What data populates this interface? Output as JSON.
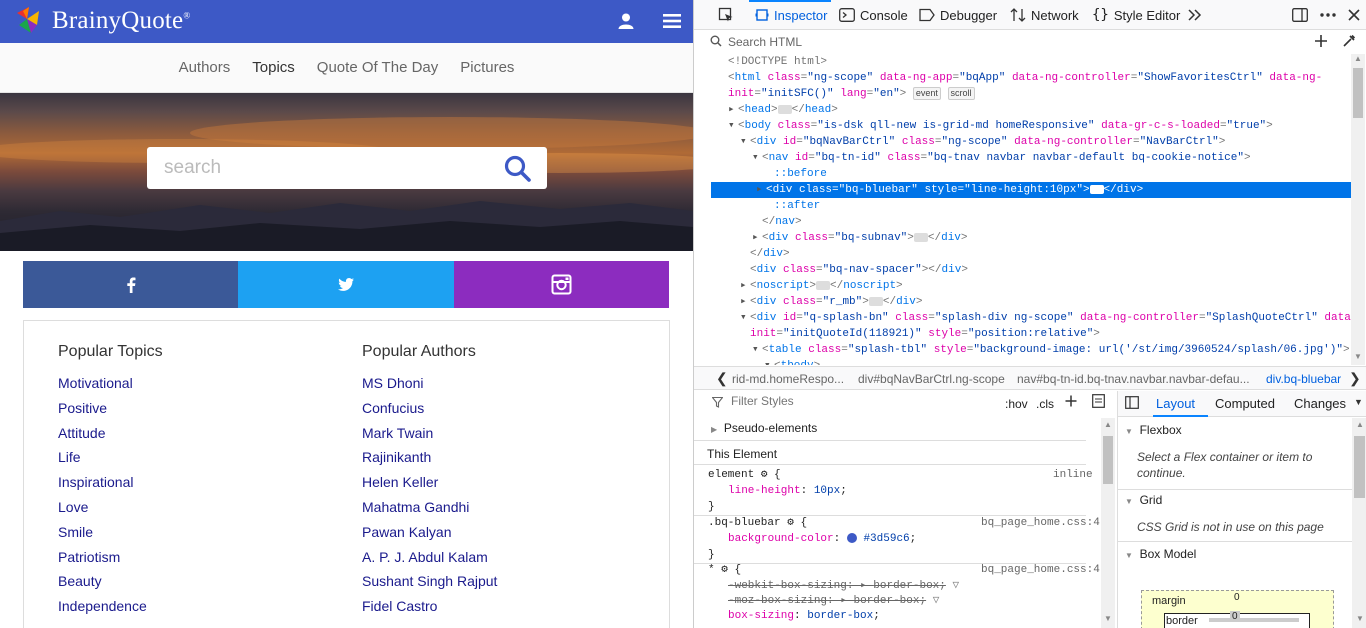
{
  "site": {
    "logo_text": "BrainyQuote",
    "logo_reg": "®",
    "subnav": [
      "Authors",
      "Topics",
      "Quote Of The Day",
      "Pictures"
    ],
    "active_subnav": "Topics",
    "search_placeholder": "search",
    "popular_topics_title": "Popular Topics",
    "popular_topics": [
      "Motivational",
      "Positive",
      "Attitude",
      "Life",
      "Inspirational",
      "Love",
      "Smile",
      "Patriotism",
      "Beauty",
      "Independence"
    ],
    "popular_authors_title": "Popular Authors",
    "popular_authors": [
      "MS Dhoni",
      "Confucius",
      "Mark Twain",
      "Rajinikanth",
      "Helen Keller",
      "Mahatma Gandhi",
      "Pawan Kalyan",
      "A. P. J. Abdul Kalam",
      "Sushant Singh Rajput",
      "Fidel Castro"
    ],
    "colors": {
      "bluebar": "#3d59c6",
      "facebook": "#3b5998",
      "twitter": "#1da1f2",
      "instagram": "#8c2cbf",
      "link": "#1a1a8c"
    }
  },
  "devtools": {
    "tabs": [
      "Inspector",
      "Console",
      "Debugger",
      "Network",
      "Style Editor"
    ],
    "active_tab": "Inspector",
    "search_placeholder": "Search HTML",
    "breadcrumbs": [
      "rid-md.homeRespo...",
      "div#bqNavBarCtrl.ng-scope",
      "nav#bq-tn-id.bq-tnav.navbar.navbar-defau...",
      "div.bq-bluebar"
    ],
    "filter_placeholder": "Filter Styles",
    "hov": ":hov",
    "cls": ".cls",
    "sidebar_tabs": [
      "Layout",
      "Computed",
      "Changes"
    ],
    "active_sidebar_tab": "Layout",
    "pseudo_elements": "Pseudo-elements",
    "this_element": "This Element",
    "flexbox_title": "Flexbox",
    "flexbox_text": "Select a Flex container or item to continue.",
    "grid_title": "Grid",
    "grid_text": "CSS Grid is not in use on this page",
    "box_model_title": "Box Model",
    "box_margin": "margin",
    "box_margin_val": "0",
    "box_border": "border",
    "box_border_val": "0",
    "rules": {
      "r1_selector": "element",
      "r1_source": "inline",
      "r1_prop": "line-height",
      "r1_val": "10px",
      "r2_selector": ".bq-bluebar",
      "r2_source": "bq_page_home.css:4",
      "r2_prop": "background-color",
      "r2_val": "#3d59c6",
      "r3_selector": "*",
      "r3_source": "bq_page_home.css:4",
      "r3_p1": "-webkit-box-sizing",
      "r3_v1": "border-box",
      "r3_p2": "-moz-box-sizing",
      "r3_v2": "border-box",
      "r3_p3": "box-sizing",
      "r3_v3": "border-box"
    }
  }
}
